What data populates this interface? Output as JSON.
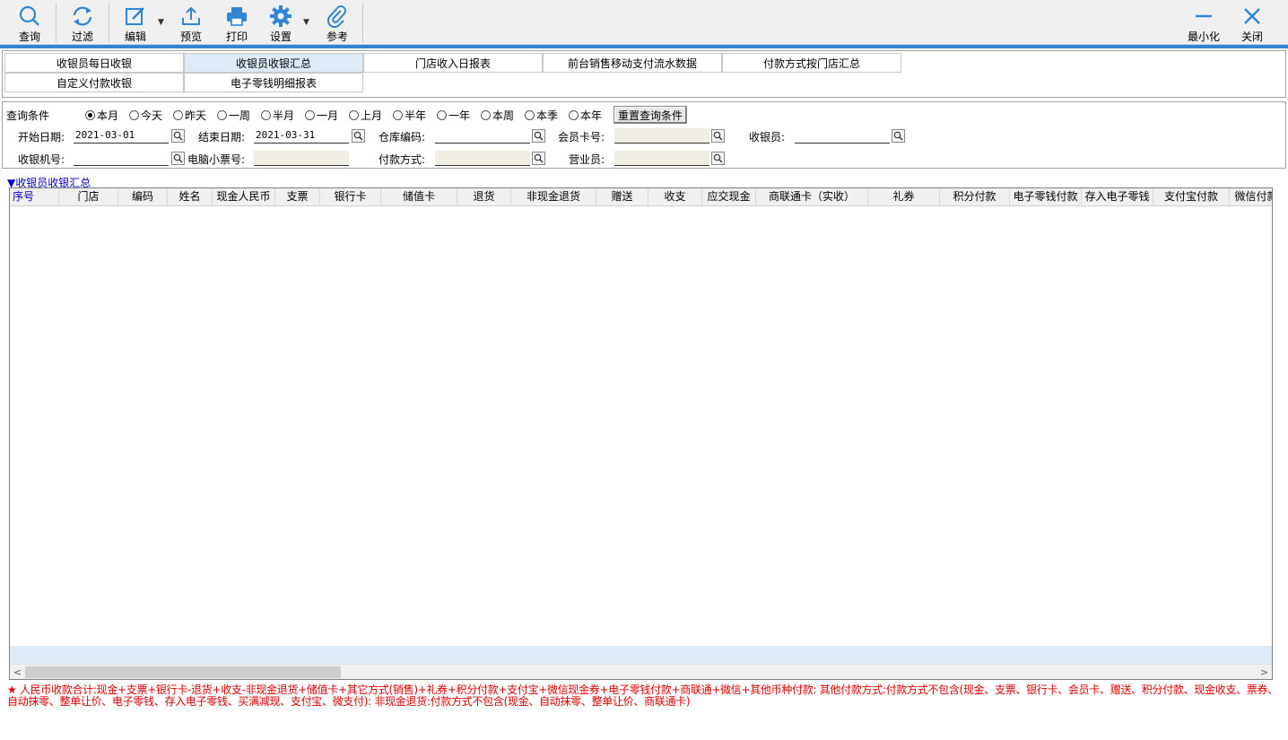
{
  "toolbar": {
    "query": "查询",
    "filter": "过滤",
    "edit": "编辑",
    "preview": "预览",
    "print": "打印",
    "settings": "设置",
    "reference": "参考",
    "minimize": "最小化",
    "close": "关闭",
    "accent_color": "#2f86d6"
  },
  "tabs": [
    "收银员每日收银",
    "收银员收银汇总",
    "门店收入日报表",
    "前台销售移动支付流水数据",
    "付款方式按门店汇总",
    "自定义付款收银",
    "电子零钱明细报表"
  ],
  "active_tab": "收银员收银汇总",
  "query": {
    "title": "查询条件",
    "ranges": [
      "本月",
      "今天",
      "昨天",
      "一周",
      "半月",
      "一月",
      "上月",
      "半年",
      "一年",
      "本周",
      "本季",
      "本年"
    ],
    "selected_range": "本月",
    "reset_label": "重置查询条件",
    "start_date_label": "开始日期:",
    "start_date": "2021-03-01",
    "end_date_label": "结束日期:",
    "end_date": "2021-03-31",
    "warehouse_label": "仓库编码:",
    "warehouse": "",
    "member_card_label": "会员卡号:",
    "member_card": "",
    "cashier_label": "收银员:",
    "cashier": "",
    "pos_label": "收银机号:",
    "pos": "",
    "receipt_label": "电脑小票号:",
    "receipt": "",
    "payment_label": "付款方式:",
    "payment": "",
    "sales_label": "营业员:",
    "sales": ""
  },
  "grid": {
    "title": "▼收银员收银汇总",
    "columns": [
      "序号",
      "门店",
      "编码",
      "姓名",
      "现金人民币",
      "支票",
      "银行卡",
      "储值卡",
      "退货",
      "非现金退货",
      "赠送",
      "收支",
      "应交现金",
      "商联通卡（实收）",
      "礼券",
      "积分付款",
      "电子零钱付款",
      "存入电子零钱",
      "支付宝付款",
      "微信付款"
    ],
    "rows": []
  },
  "footnote": "★ 人民币收款合计:现金+支票+银行卡-退货+收支-非现金退货+储值卡+其它方式(销售)+礼券+积分付款+支付宝+微信现金券+电子零钱付款+商联通+微信+其他币种付款:   其他付款方式:付款方式不包含(现金、支票、银行卡、会员卡、赠送、积分付款、现金收支、票券、自动抹零、整单让价、电子零钱、存入电子零钱、买满减现、支付宝、微支付):   非现金退货:付款方式不包含(现金、自动抹零、整单让价、商联通卡)"
}
